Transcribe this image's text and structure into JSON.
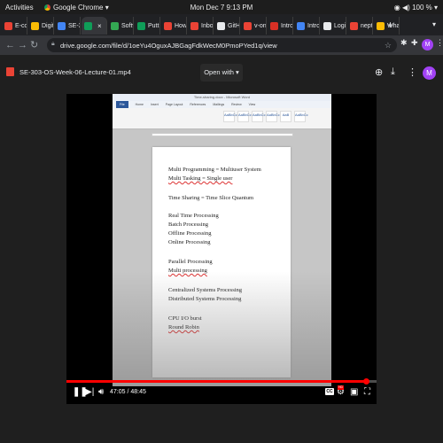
{
  "os_bar": {
    "activities": "Activities",
    "app_name": "Google Chrome ▾",
    "clock": "Mon Dec 7  9:13 PM",
    "battery": "100 %"
  },
  "tabs": [
    {
      "label": "E-con",
      "color": "#ea4335"
    },
    {
      "label": "Digit",
      "color": "#fbbc05"
    },
    {
      "label": "SE-30",
      "color": "#4285f4"
    },
    {
      "label": "",
      "color": "#0f9d58",
      "active": true
    },
    {
      "label": "Softw",
      "color": "#34a853"
    },
    {
      "label": "Putt",
      "color": "#0f9d58"
    },
    {
      "label": "How",
      "color": "#ea4335"
    },
    {
      "label": "Inbox",
      "color": "#ea4335"
    },
    {
      "label": "GitH",
      "color": "#e8eaed"
    },
    {
      "label": "v-onc",
      "color": "#ea4335"
    },
    {
      "label": "Intro",
      "color": "#d93025"
    },
    {
      "label": "Intro",
      "color": "#4285f4"
    },
    {
      "label": "Login",
      "color": "#e8eaed"
    },
    {
      "label": "nept",
      "color": "#ea4335"
    },
    {
      "label": "What",
      "color": "#fbbc05"
    }
  ],
  "omnibox": {
    "url": "drive.google.com/file/d/1oeYu4OguxAJBGagFdkWecM0PmoPYed1q/view"
  },
  "viewer": {
    "file_name": "SE-303-OS-Week-06-Lecture-01.mp4",
    "open_with": "Open with ▾",
    "avatar_initial": "M"
  },
  "word_window": {
    "title": "Time-sharing.docx - Microsoft Word",
    "ribbon_tabs": [
      "File",
      "Home",
      "Insert",
      "Page Layout",
      "References",
      "Mailings",
      "Review",
      "View"
    ],
    "styles": [
      "AaBbCcDc",
      "AaBbCcDc",
      "AaBbCc",
      "AaBbCc",
      "AaB",
      "AaBbCc"
    ]
  },
  "document": {
    "lines": [
      {
        "text": "Multi Programming = Multiuser System",
        "squiggle": false
      },
      {
        "text": "Multi Tasking = Single user",
        "squiggle": true
      },
      {
        "text": "Time Sharing = Time Slice Quantum",
        "squiggle": false
      },
      {
        "text": "Real Time Processing",
        "squiggle": false
      },
      {
        "text": "Batch Processing",
        "squiggle": false
      },
      {
        "text": "Offline Processing",
        "squiggle": false
      },
      {
        "text": "Online Processing",
        "squiggle": false
      },
      {
        "text": "Parallel Processing",
        "squiggle": false
      },
      {
        "text": "Multi processing",
        "squiggle": true
      },
      {
        "text": "Centralized Systems Processing",
        "squiggle": false
      },
      {
        "text": "Distributed Systems Processing",
        "squiggle": false
      },
      {
        "text": "CPU I/O burst",
        "squiggle": false
      },
      {
        "text": "Round Robin",
        "squiggle": true
      }
    ]
  },
  "player": {
    "timecode": "47:05 / 48:45",
    "progress_fraction": 0.9658,
    "cc_label": "CC",
    "hd_label": "HD"
  },
  "colors": {
    "accent_red": "#ff0000",
    "chrome_dark": "#202124",
    "avatar_purple": "#a142f4"
  }
}
